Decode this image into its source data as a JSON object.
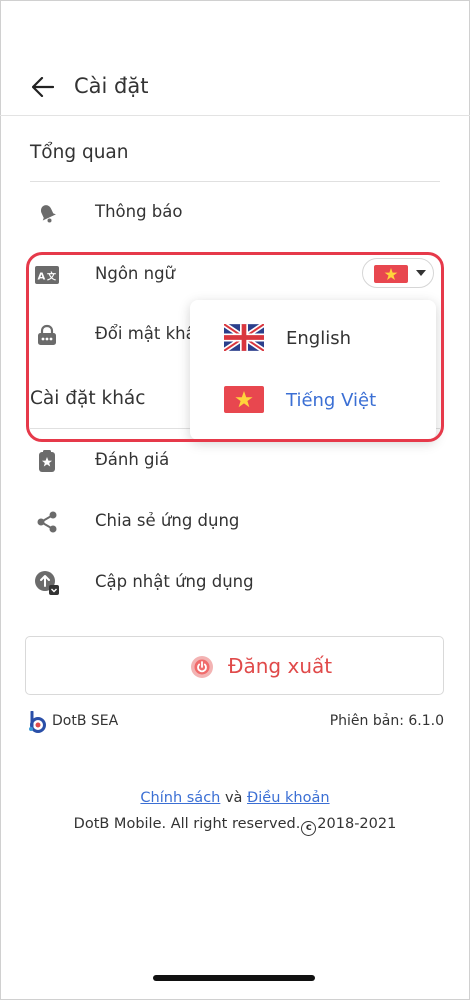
{
  "colors": {
    "accent_blue": "#3b6fd4",
    "logout_red": "#e04a4a",
    "highlight_red": "#e6394a",
    "icon_gray": "#6b6b6b"
  },
  "header": {
    "back_icon": "arrow-left-icon",
    "title": "Cài đặt"
  },
  "general": {
    "section_title": "Tổng quan",
    "items": [
      {
        "icon": "bell-icon",
        "label": "Thông báo"
      },
      {
        "icon": "translate-icon",
        "label": "Ngôn ngữ",
        "value_icon": "vietnam-flag-icon"
      },
      {
        "icon": "lock-password-icon",
        "label": "Đổi mật khẩu"
      }
    ]
  },
  "language_dropdown": {
    "options": [
      {
        "icon": "uk-flag-icon",
        "label": "English",
        "selected": false
      },
      {
        "icon": "vietnam-flag-icon",
        "label": "Tiếng Việt",
        "selected": true
      }
    ]
  },
  "other": {
    "section_title": "Cài đặt khác",
    "items": [
      {
        "icon": "rate-star-icon",
        "label": "Đánh giá"
      },
      {
        "icon": "share-icon",
        "label": "Chia sẻ ứng dụng"
      },
      {
        "icon": "update-icon",
        "label": "Cập nhật ứng dụng"
      }
    ]
  },
  "logout": {
    "icon": "power-icon",
    "label": "Đăng xuất"
  },
  "footer": {
    "brand_name": "DotB SEA",
    "version_label": "Phiên bản: 6.1.0",
    "policy_link": "Chính sách",
    "and_text": "và",
    "terms_link": "Điều khoản",
    "copyright_prefix": "DotB Mobile. All right reserved.",
    "copyright_years": "2018-2021"
  }
}
